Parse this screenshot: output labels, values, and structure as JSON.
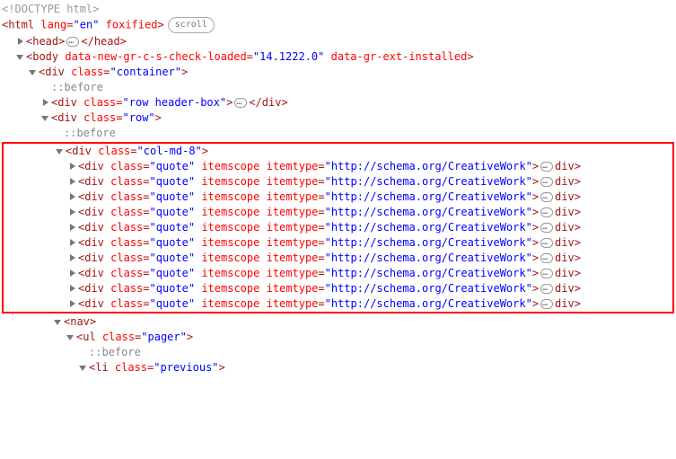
{
  "doctype": "<!DOCTYPE html>",
  "html_open": {
    "p1": "<",
    "tag": "html",
    "attr1": "lang",
    "val1": "\"en\"",
    "attr2": "foxified",
    "p2": ">",
    "badge": "scroll"
  },
  "head": {
    "open_p1": "<",
    "open_tag": "head",
    "open_p2": ">",
    "close_p1": "</",
    "close_tag": "head",
    "close_p2": ">"
  },
  "body": {
    "p1": "<",
    "tag": "body",
    "a1": "data-new-gr-c-s-check-loaded",
    "v1": "\"14.1222.0\"",
    "a2": "data-gr-ext-installed",
    "p2": ">"
  },
  "container": {
    "p1": "<",
    "tag": "div",
    "a": "class",
    "v": "\"container\"",
    "p2": ">"
  },
  "before": "::before",
  "header_open": {
    "p1": "<",
    "tag": "div",
    "a": "class",
    "v": "\"row header-box\"",
    "p2": ">"
  },
  "header_close": {
    "p1": "</",
    "tag": "div",
    "p2": ">"
  },
  "row": {
    "p1": "<",
    "tag": "div",
    "a": "class",
    "v": "\"row\"",
    "p2": ">"
  },
  "col": {
    "p1": "<",
    "tag": "div",
    "a": "class",
    "v": "\"col-md-8\"",
    "p2": ">"
  },
  "quote": {
    "p1": "<",
    "tag": "div",
    "a1": "class",
    "v1": "\"quote\"",
    "a2": "itemscope",
    "a3": "itemtype",
    "v3": "\"http://schema.org/CreativeWork\"",
    "p2": ">",
    "cp1": "</",
    "ctag": "div",
    "cp2": ">"
  },
  "nav": {
    "p1": "<",
    "tag": "nav",
    "p2": ">"
  },
  "pager": {
    "p1": "<",
    "tag": "ul",
    "a": "class",
    "v": "\"pager\"",
    "p2": ">"
  },
  "prev": {
    "p1": "<",
    "tag": "li",
    "a": "class",
    "v": "\"previous\"",
    "p2": ">"
  }
}
